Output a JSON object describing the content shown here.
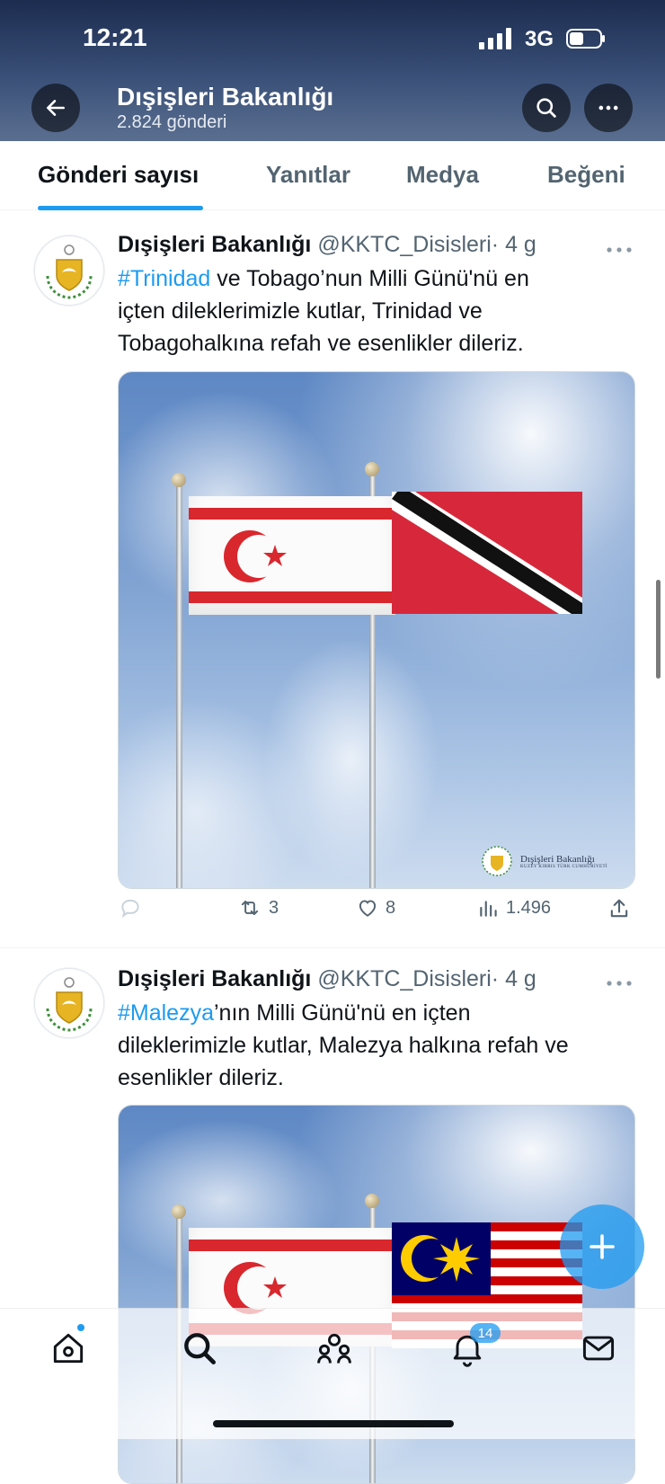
{
  "status_bar": {
    "time": "12:21",
    "network": "3G"
  },
  "profile_header": {
    "title": "Dışişleri Bakanlığı",
    "subtitle": "2.824 gönderi"
  },
  "tabs": [
    {
      "label": "Gönderi sayısı",
      "active": true
    },
    {
      "label": "Yanıtlar",
      "active": false
    },
    {
      "label": "Medya",
      "active": false
    },
    {
      "label": "Beğeni",
      "active": false
    }
  ],
  "tweets": [
    {
      "name": "Dışişleri Bakanlığı",
      "handle": "@KKTC_Disisleri",
      "separator": "·",
      "time": "4 g",
      "hashtag": "#Trinidad",
      "line1_rest": " ve Tobago’nun Milli Günü'nü en",
      "line2": "içten dileklerimizle kutlar, Trinidad ve",
      "line3": "Tobagohalkına refah ve esenlikler dileriz.",
      "media_watermark": {
        "title": "Dışişleri Bakanlığı",
        "subtitle": "KUZEY KIBRIS TÜRK CUMHURİYETİ"
      },
      "stats": {
        "replies": "",
        "retweets": "3",
        "likes": "8",
        "views": "1.496"
      }
    },
    {
      "name": "Dışişleri Bakanlığı",
      "handle": "@KKTC_Disisleri",
      "separator": "·",
      "time": "4 g",
      "hashtag": "#Malezya",
      "line1_rest": "’nın Milli Günü'nü en içten",
      "line2": "dileklerimizle kutlar, Malezya halkına refah ve",
      "line3": "esenlikler dileriz."
    }
  ],
  "bottom_nav": {
    "items": [
      "home-icon",
      "search-icon",
      "communities-icon",
      "notifications-icon",
      "messages-icon"
    ],
    "notification_badge": "14"
  },
  "colors": {
    "accent": "#1d9bf0",
    "text": "#0f1419",
    "secondary": "#536471"
  }
}
